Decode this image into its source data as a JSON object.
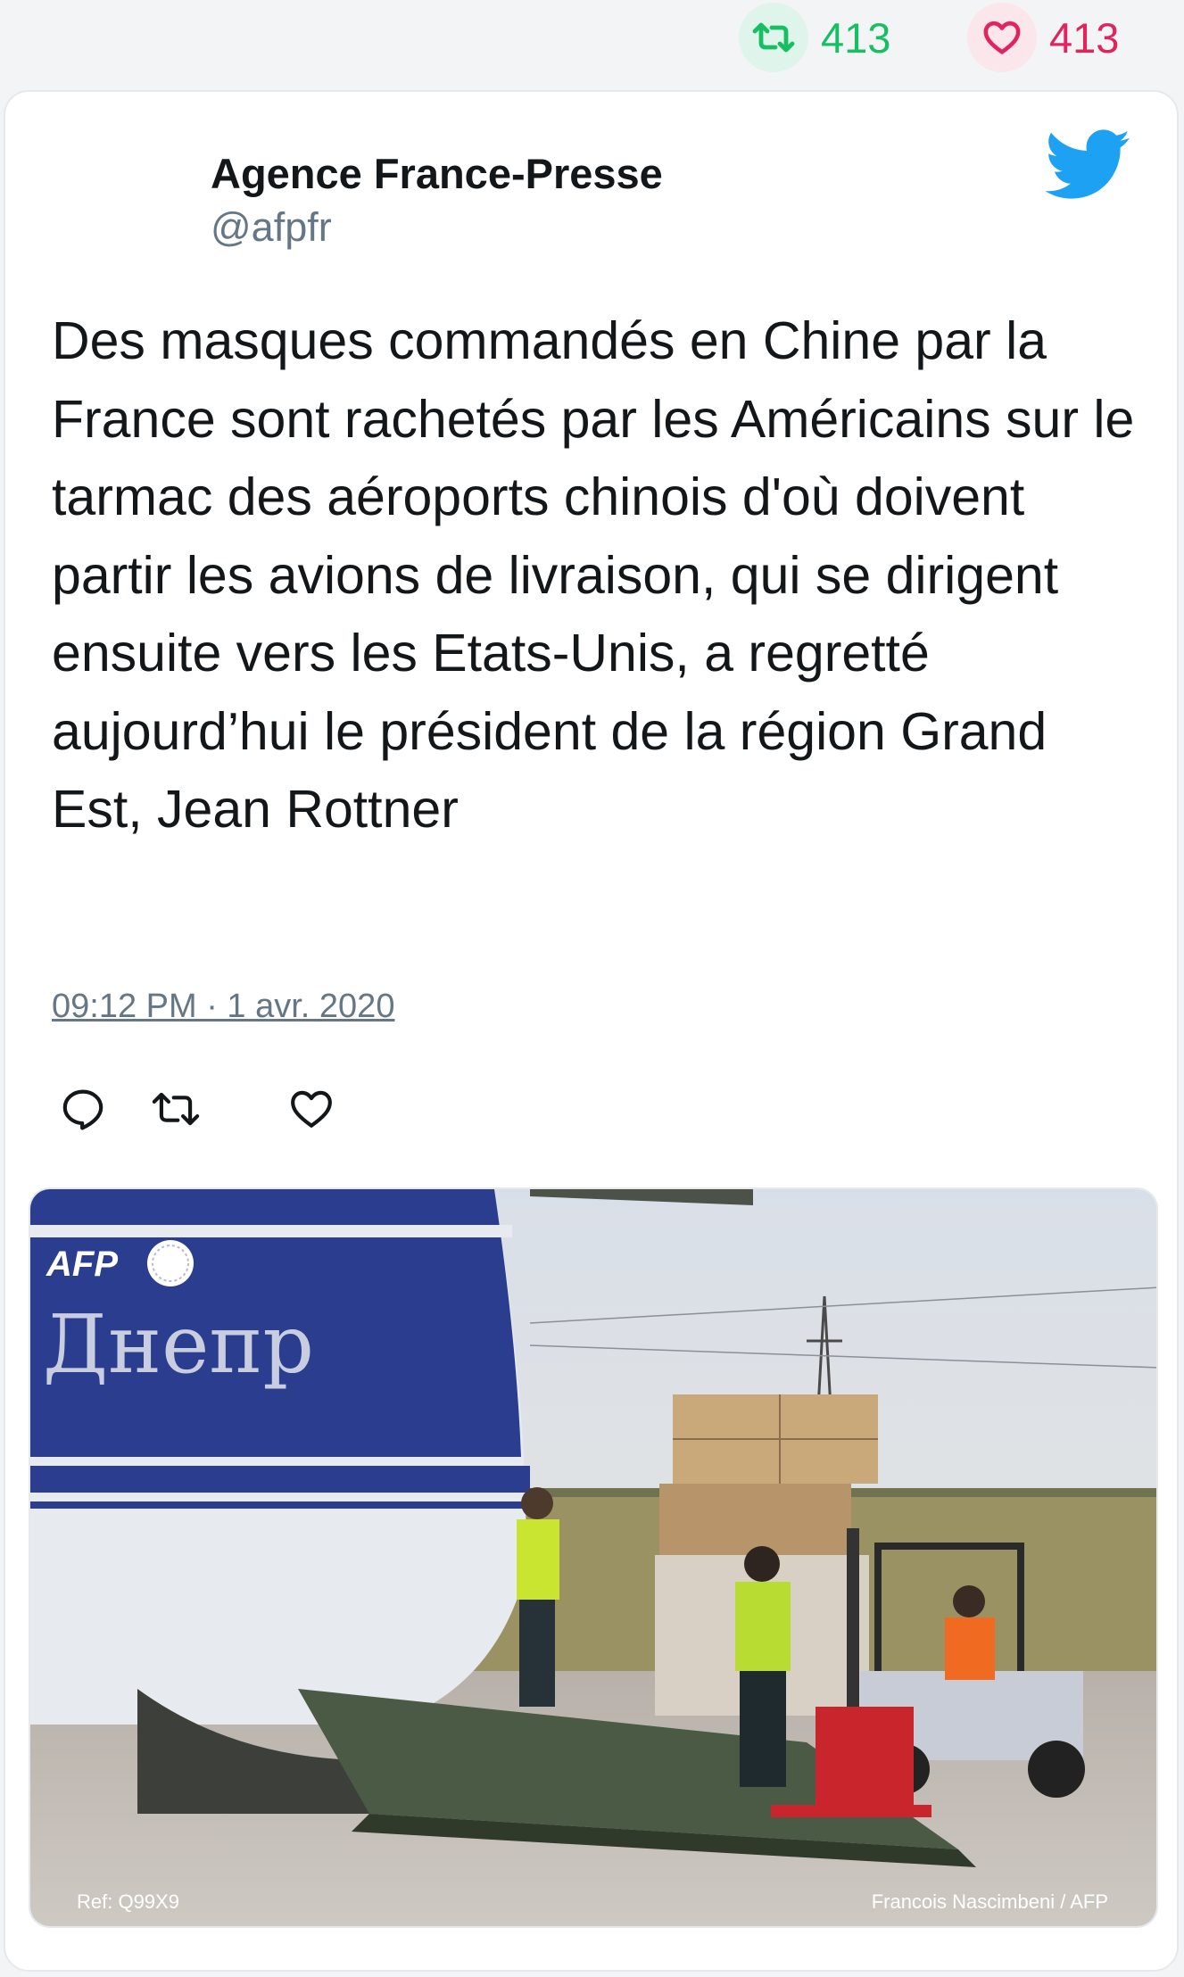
{
  "stats": {
    "retweets": "413",
    "likes": "413"
  },
  "author": {
    "name": "Agence France-Presse",
    "handle": "@afpfr"
  },
  "tweet": {
    "text": "Des masques commandés en Chine par la France sont rachetés par les Américains sur le tarmac des aéroports chinois d'où doivent partir les avions de livraison, qui se dirigent ensuite vers les Etats-Unis, a regretté aujourd’hui le président de la région Grand Est, Jean Rottner",
    "timestamp": "09:12 PM · 1 avr. 2020"
  },
  "media": {
    "logo": "AFP",
    "plane_lettering": "Днепр",
    "ref": "Ref: Q99X9",
    "credit": "Francois Nascimbeni / AFP"
  },
  "icons": {
    "retweet": "retweet-icon",
    "like": "heart-icon",
    "reply": "reply-icon",
    "brand": "twitter-bird-icon"
  },
  "colors": {
    "retweet": "#17bf63",
    "like": "#e0245e",
    "twitter_blue": "#1da1f2",
    "secondary_text": "#657786"
  }
}
